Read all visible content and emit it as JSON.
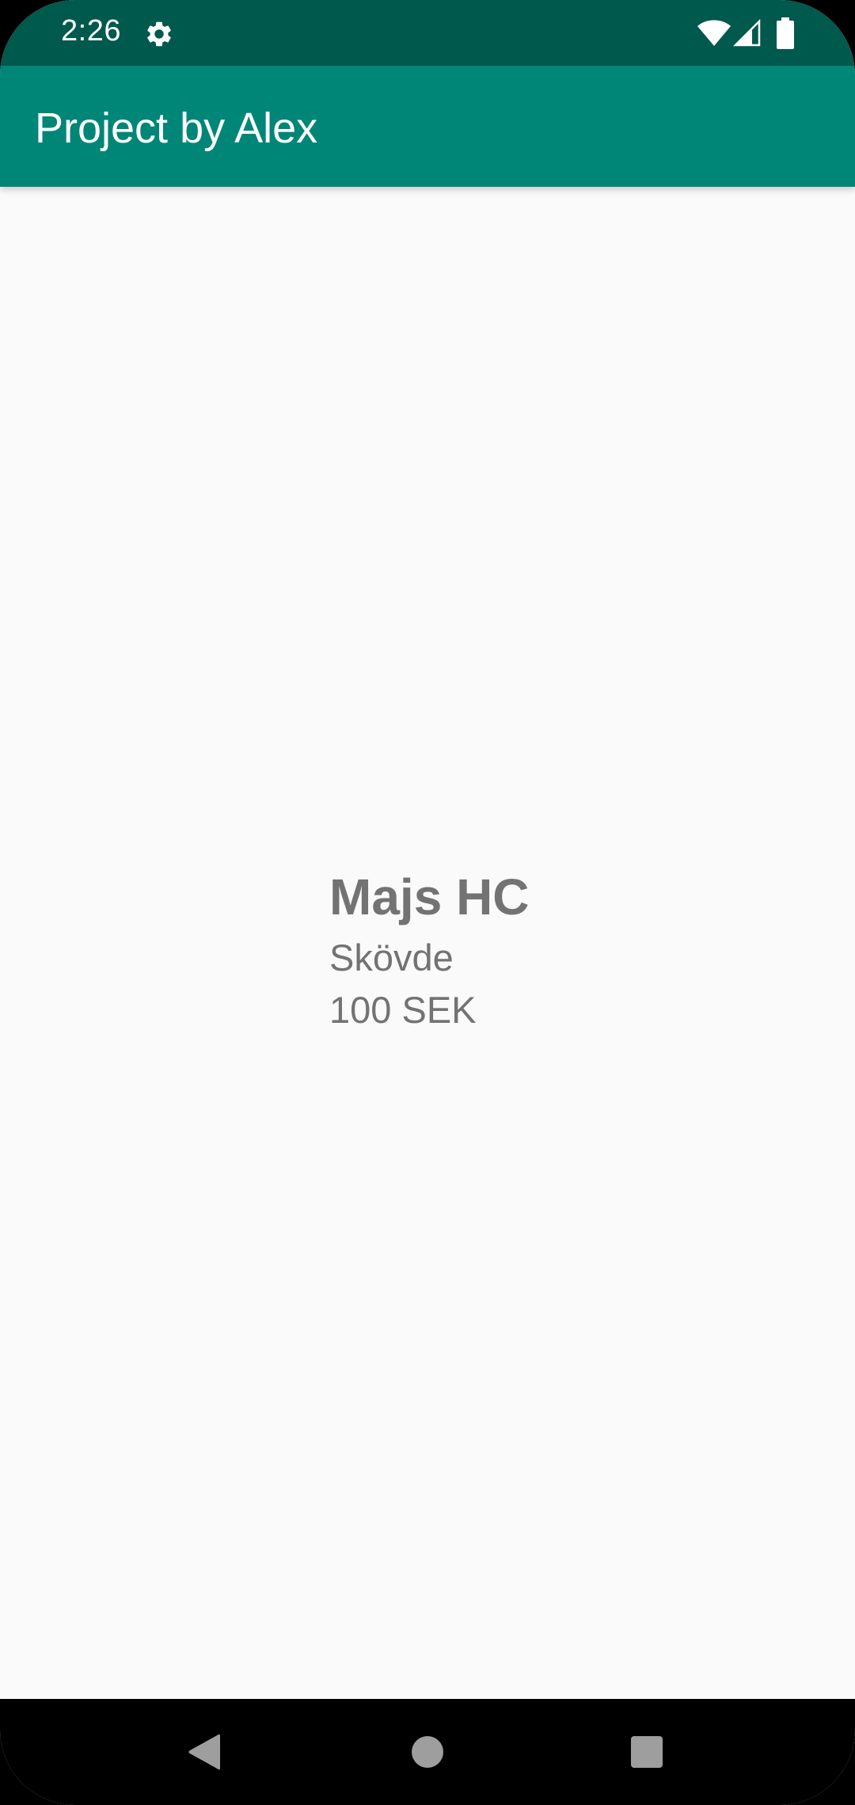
{
  "status_bar": {
    "time": "2:26",
    "icons": [
      "gear-icon",
      "wifi-icon",
      "cell-signal-icon",
      "battery-icon"
    ],
    "background": "#00594d"
  },
  "app_bar": {
    "title": "Project by Alex",
    "background": "#008677"
  },
  "detail": {
    "name": "Majs HC",
    "location": "Skövde",
    "price": "100 SEK",
    "text_color": "#737373"
  },
  "nav_bar": {
    "buttons": [
      "back-icon",
      "home-icon",
      "recents-icon"
    ],
    "icon_color": "#9e9e9e"
  }
}
